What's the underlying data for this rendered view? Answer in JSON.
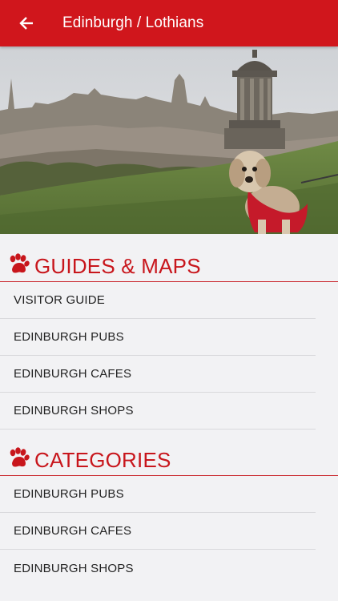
{
  "appbar": {
    "title": "Edinburgh / Lothians",
    "back_icon": "arrow-left-icon",
    "color": "#d0161c"
  },
  "hero": {
    "image": "edinburgh-skyline-with-dog"
  },
  "sections": [
    {
      "title": "GUIDES & MAPS",
      "icon": "paw-icon",
      "items": [
        "VISITOR GUIDE",
        "EDINBURGH PUBS",
        "EDINBURGH CAFES",
        "EDINBURGH SHOPS"
      ]
    },
    {
      "title": "CATEGORIES",
      "icon": "paw-icon",
      "items": [
        "EDINBURGH PUBS",
        "EDINBURGH CAFES",
        "EDINBURGH SHOPS"
      ]
    }
  ]
}
